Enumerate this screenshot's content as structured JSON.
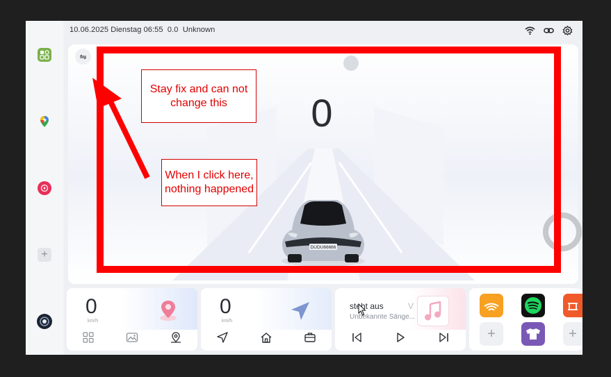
{
  "status_bar": {
    "datetime": "10.06.2025 Dienstag 06:55",
    "value": "0.0",
    "location": "Unknown"
  },
  "dock": {
    "icons": [
      "apps-grid-icon",
      "google-maps-icon",
      "music-icon",
      "add-icon",
      "dashboard-icon"
    ],
    "add_label": "+"
  },
  "main": {
    "menu_icon": "⇋",
    "speed": "0",
    "license_plate": "DUDU66666"
  },
  "annotations": {
    "note1": "Stay fix and can not change this",
    "note2": "When I click here, nothing happened"
  },
  "widgets": {
    "speed1": "0",
    "unit1": "km/h",
    "speed2": "0",
    "unit2": "km/h",
    "music": {
      "title": "steht aus",
      "title_next": "V",
      "artist": "Unbekannte Sänge..."
    },
    "apps_add": "+"
  },
  "colors": {
    "annotation_red": "#ff0000",
    "accent_pink": "#e8305a",
    "nav_blue": "#7d96cf"
  }
}
